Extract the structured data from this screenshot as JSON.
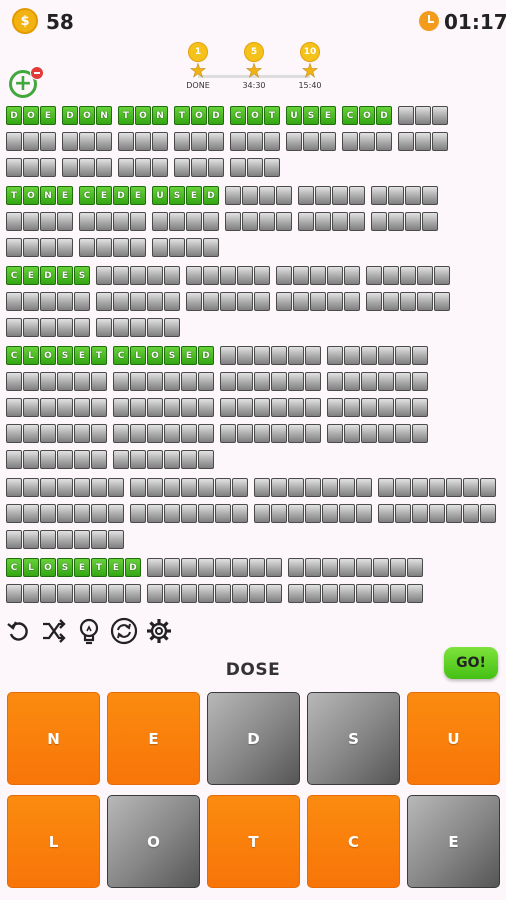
{
  "header": {
    "coins": "58",
    "coin_symbol": "$",
    "timer": "01:17"
  },
  "milestones": [
    {
      "reward": "1",
      "label": "DONE"
    },
    {
      "reward": "5",
      "label": "34:30"
    },
    {
      "reward": "10",
      "label": "15:40"
    }
  ],
  "add_button_symbol": "+",
  "current_word": "DOSE",
  "go_label": "GO!",
  "letters": [
    {
      "letter": "N",
      "state": "orange"
    },
    {
      "letter": "E",
      "state": "orange"
    },
    {
      "letter": "D",
      "state": "gray"
    },
    {
      "letter": "S",
      "state": "gray"
    },
    {
      "letter": "U",
      "state": "orange"
    },
    {
      "letter": "L",
      "state": "orange"
    },
    {
      "letter": "O",
      "state": "gray"
    },
    {
      "letter": "T",
      "state": "orange"
    },
    {
      "letter": "C",
      "state": "orange"
    },
    {
      "letter": "E",
      "state": "gray"
    }
  ],
  "tools": [
    "undo-icon",
    "shuffle-icon",
    "hint-bulb-icon",
    "refresh-icon",
    "gear-icon"
  ],
  "word_grid": {
    "sections": [
      {
        "length": 3,
        "found": [
          "DOE",
          "DON",
          "TON",
          "TOD",
          "COT",
          "USE",
          "COD"
        ],
        "hidden": 14
      },
      {
        "length": 4,
        "found": [
          "TONE",
          "CEDE",
          "USED"
        ],
        "hidden": 12
      },
      {
        "length": 5,
        "found": [
          "CEDES"
        ],
        "hidden": 11
      },
      {
        "length": 6,
        "found": [
          "CLOSET",
          "CLOSED"
        ],
        "hidden": 16
      },
      {
        "length": 7,
        "found": [],
        "hidden": 9
      },
      {
        "length": 8,
        "found": [
          "CLOSETED"
        ],
        "hidden": 5
      }
    ]
  }
}
